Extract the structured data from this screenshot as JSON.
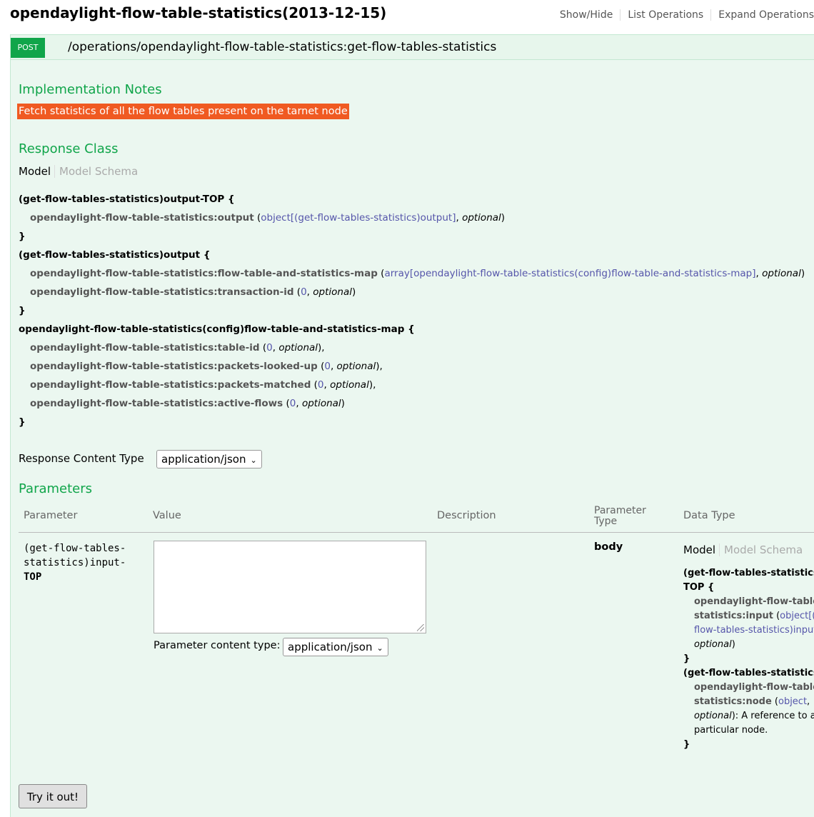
{
  "heading": "opendaylight-flow-table-statistics(2013-12-15)",
  "top_links": {
    "show_hide": "Show/Hide",
    "list_operations": "List Operations",
    "expand_operations": "Expand Operations"
  },
  "operation": {
    "method": "POST",
    "path": "/operations/opendaylight-flow-table-statistics:get-flow-tables-statistics"
  },
  "implementation_notes": {
    "title": "Implementation Notes",
    "text": "Fetch statistics of all the flow tables present on the tarnet node"
  },
  "response_class": {
    "title": "Response Class",
    "tab_model": "Model",
    "tab_schema": "Model Schema",
    "signature": {
      "output_top_name": "(get-flow-tables-statistics)output-TOP {",
      "output_top_prop": "opendaylight-flow-table-statistics:output",
      "output_top_type": "object[(get-flow-tables-statistics)output]",
      "output_name": "(get-flow-tables-statistics)output {",
      "map_prop": "opendaylight-flow-table-statistics:flow-table-and-statistics-map",
      "map_type": "array[opendaylight-flow-table-statistics(config)flow-table-and-statistics-map]",
      "txid_prop": "opendaylight-flow-table-statistics:transaction-id",
      "map_name": "opendaylight-flow-table-statistics(config)flow-table-and-statistics-map {",
      "table_id_prop": "opendaylight-flow-table-statistics:table-id",
      "looked_up_prop": "opendaylight-flow-table-statistics:packets-looked-up",
      "matched_prop": "opendaylight-flow-table-statistics:packets-matched",
      "active_prop": "opendaylight-flow-table-statistics:active-flows",
      "zero": "0",
      "optional": "optional",
      "close": "}"
    }
  },
  "response_content_type": {
    "label": "Response Content Type",
    "value": "application/json"
  },
  "parameters": {
    "title": "Parameters",
    "headers": {
      "parameter": "Parameter",
      "value": "Value",
      "description": "Description",
      "param_type_1": "Parameter",
      "param_type_2": "Type",
      "data_type": "Data Type"
    },
    "row": {
      "name_1": "(get-flow-tables-",
      "name_2": "statistics)input-",
      "name_3": "TOP",
      "value": "",
      "content_type_label": "Parameter content type:",
      "content_type_value": "application/json",
      "param_type": "body",
      "dt_tab_model": "Model",
      "dt_tab_schema": "Model Schema",
      "dt": {
        "l1": "(get-flow-tables-statistics)input-",
        "l2": "TOP {",
        "l3": "opendaylight-flow-table-",
        "l4": "statistics:input",
        "l4_type": "object[(get-",
        "l5": "flow-tables-statistics)input]",
        "l6": "optional",
        "l7": "}",
        "l8": "(get-flow-tables-statistics)input {",
        "l9": "opendaylight-flow-table-",
        "l10": "statistics:node",
        "l10_type": "object",
        "l11_opt": "optional",
        "l11_text": ": A reference to a",
        "l12": "particular node.",
        "l13": "}"
      }
    }
  },
  "try_button": "Try it out!"
}
